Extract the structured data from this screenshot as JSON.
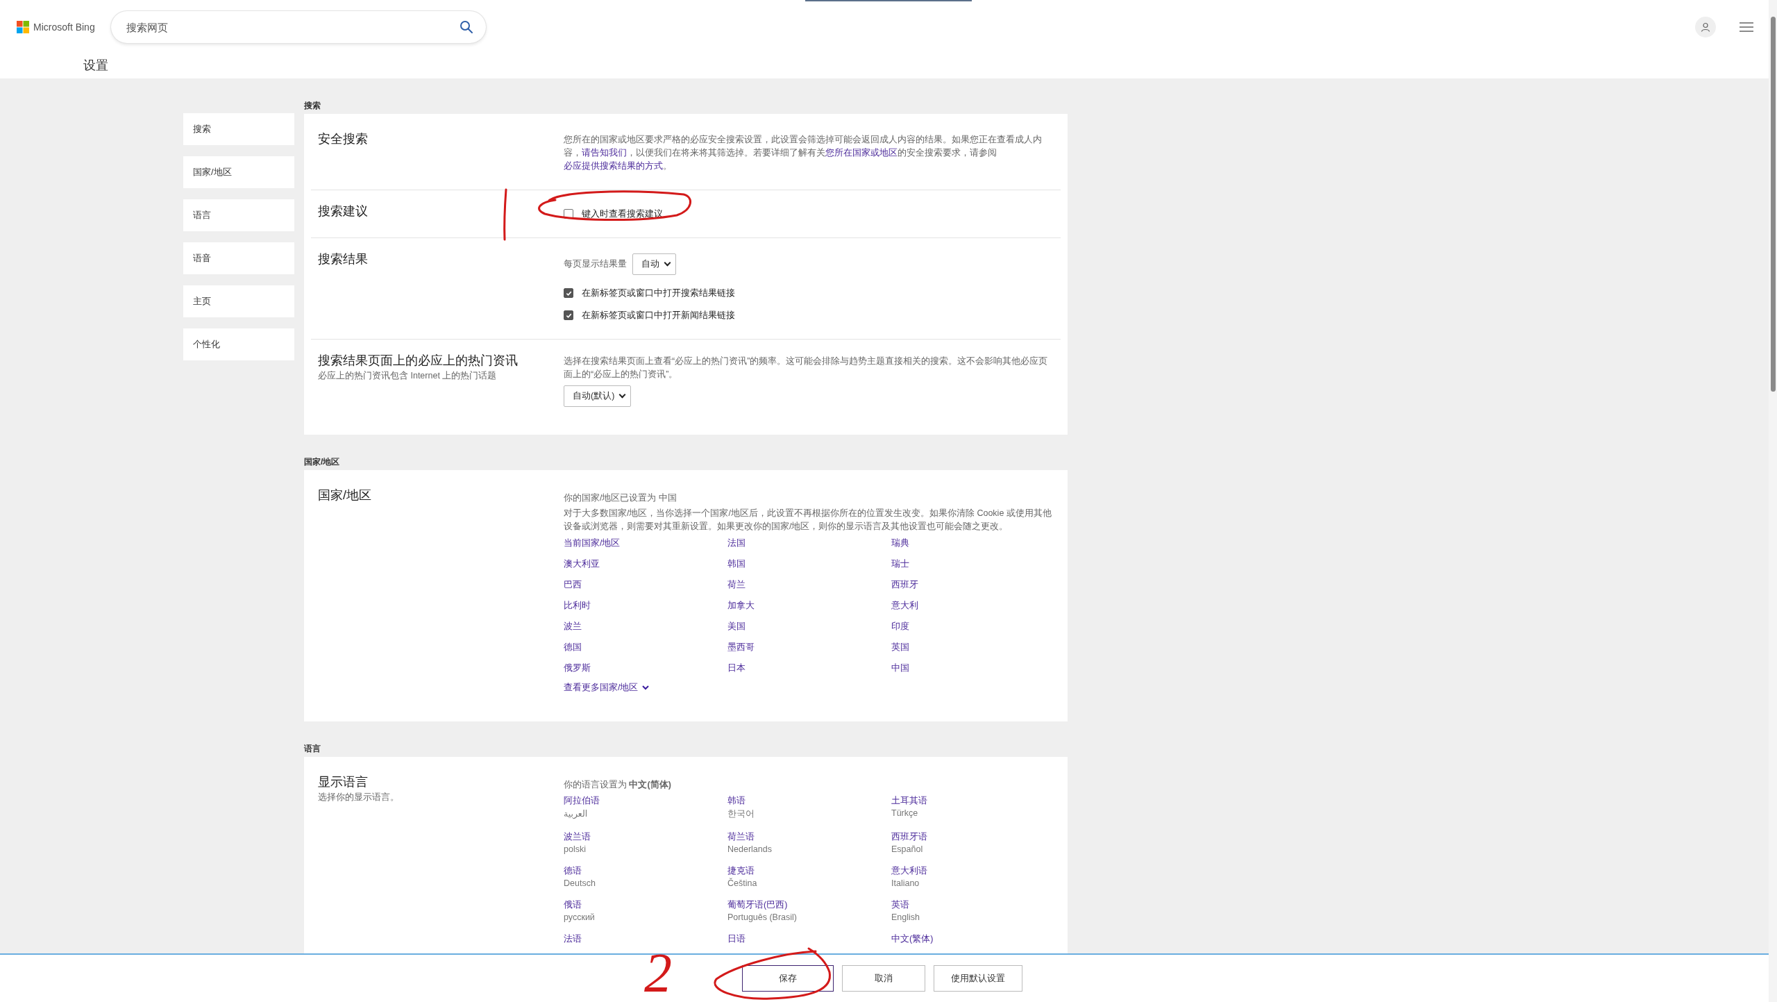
{
  "header": {
    "brand": "Microsoft Bing",
    "search": {
      "placeholder": "搜索网页"
    },
    "page_title": "设置"
  },
  "sidebar": {
    "items": [
      {
        "label": "搜索"
      },
      {
        "label": "国家/地区"
      },
      {
        "label": "语言"
      },
      {
        "label": "语音"
      },
      {
        "label": "主页"
      },
      {
        "label": "个性化"
      }
    ]
  },
  "sections": [
    {
      "heading": "搜索",
      "rows": [
        {
          "kind": "text",
          "title": "安全搜索",
          "segments": [
            {
              "text": "您所在的国家或地区要求严格的必应安全搜索设置，此设置会筛选掉可能会返回成人内容的结果。如果您正在查看成人内容，"
            },
            {
              "text": "请告知我们",
              "link": true
            },
            {
              "text": "，以便我们在将来将其筛选掉。若要详细了解有关"
            },
            {
              "text": "您所在国家或地区",
              "link": true
            },
            {
              "text": "的安全搜索要求，请参阅"
            },
            {
              "text": "必应提供搜索结果的方式",
              "link": true
            },
            {
              "text": "。"
            }
          ]
        },
        {
          "kind": "checks",
          "title": "搜索建议",
          "checks": [
            {
              "label": "键入时查看搜索建议",
              "checked": false
            }
          ]
        },
        {
          "kind": "results",
          "title": "搜索结果",
          "count_label": "每页显示结果量",
          "select": "自动",
          "checks": [
            {
              "label": "在新标签页或窗口中打开搜索结果链接",
              "checked": true
            },
            {
              "label": "在新标签页或窗口中打开新闻结果链接",
              "checked": true
            }
          ]
        },
        {
          "kind": "select",
          "title": "搜索结果页面上的必应上的热门资讯",
          "subtitle": "必应上的热门资讯包含 Internet 上的热门话题",
          "description": "选择在搜索结果页面上查看“必应上的热门资讯”的频率。这可能会排除与趋势主题直接相关的搜索。这不会影响其他必应页面上的“必应上的热门资讯”。",
          "select": "自动(默认)"
        }
      ]
    },
    {
      "heading": "国家/地区",
      "rows": [
        {
          "kind": "links",
          "title": "国家/地区",
          "note": "你的国家/地区已设置为 中国",
          "description": "对于大多数国家/地区，当你选择一个国家/地区后，此设置不再根据你所在的位置发生改变。如果你清除 Cookie 或使用其他设备或浏览器，则需要对其重新设置。如果更改你的国家/地区，则你的显示语言及其他设置也可能会随之更改。",
          "links": [
            "当前国家/地区",
            "法国",
            "瑞典",
            "澳大利亚",
            "韩国",
            "瑞士",
            "巴西",
            "荷兰",
            "西班牙",
            "比利时",
            "加拿大",
            "意大利",
            "波兰",
            "美国",
            "印度",
            "德国",
            "墨西哥",
            "英国",
            "俄罗斯",
            "日本",
            "中国"
          ],
          "more": "查看更多国家/地区"
        }
      ]
    },
    {
      "heading": "语言",
      "rows": [
        {
          "kind": "languages",
          "title": "显示语言",
          "subtitle": "选择你的显示语言。",
          "note": "你的语言设置为 **中文(简体)**",
          "languages": [
            {
              "name": "阿拉伯语",
              "native": "العربية"
            },
            {
              "name": "韩语",
              "native": "한국어"
            },
            {
              "name": "土耳其语",
              "native": "Türkçe"
            },
            {
              "name": "波兰语",
              "native": "polski"
            },
            {
              "name": "荷兰语",
              "native": "Nederlands"
            },
            {
              "name": "西班牙语",
              "native": "Español"
            },
            {
              "name": "德语",
              "native": "Deutsch"
            },
            {
              "name": "捷克语",
              "native": "Čeština"
            },
            {
              "name": "意大利语",
              "native": "Italiano"
            },
            {
              "name": "俄语",
              "native": "русский"
            },
            {
              "name": "葡萄牙语(巴西)",
              "native": "Português (Brasil)"
            },
            {
              "name": "英语",
              "native": "English"
            },
            {
              "name": "法语"
            },
            {
              "name": "日语"
            },
            {
              "name": "中文(繁体)"
            }
          ]
        }
      ]
    }
  ],
  "footer": {
    "buttons": [
      {
        "label": "保存",
        "primary": true
      },
      {
        "label": "取消",
        "primary": false
      },
      {
        "label": "使用默认设置",
        "primary": false
      }
    ]
  },
  "annotations": [
    {
      "kind": "line"
    },
    {
      "kind": "ellipse"
    },
    {
      "kind": "number",
      "text": "2"
    },
    {
      "kind": "ellipse"
    }
  ]
}
